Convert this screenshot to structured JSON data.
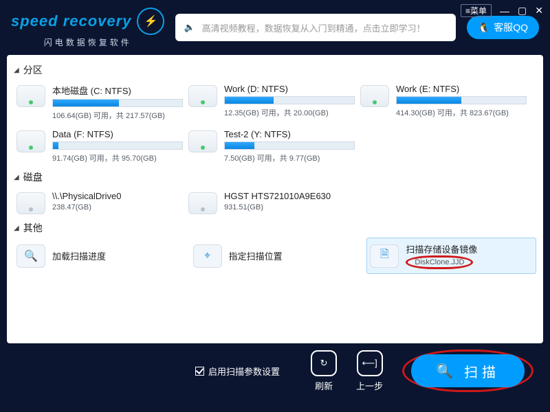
{
  "header": {
    "logo_text": "speed recovery",
    "logo_sub": "闪电数据恢复软件",
    "tutorial": "高清视频教程，数据恢复从入门到精通，点击立即学习！",
    "qq_label": "客服QQ",
    "menu_label": "菜单"
  },
  "sections": {
    "partition": "分区",
    "disk": "磁盘",
    "other": "其他"
  },
  "partitions": [
    {
      "title": "本地磁盘 (C: NTFS)",
      "meta": "106.64(GB) 可用，共 217.57(GB)",
      "fill": 51
    },
    {
      "title": "Work (D: NTFS)",
      "meta": "12.35(GB) 可用，共 20.00(GB)",
      "fill": 38
    },
    {
      "title": "Work (E: NTFS)",
      "meta": "414.30(GB) 可用，共 823.67(GB)",
      "fill": 50
    },
    {
      "title": "Data (F: NTFS)",
      "meta": "91.74(GB) 可用，共 95.70(GB)",
      "fill": 4
    },
    {
      "title": "Test-2 (Y: NTFS)",
      "meta": "7.50(GB) 可用，共 9.77(GB)",
      "fill": 23
    }
  ],
  "disks": [
    {
      "title": "\\\\.\\PhysicalDrive0",
      "meta": "238.47(GB)"
    },
    {
      "title": "HGST HTS721010A9E630",
      "meta": "931.51(GB)"
    }
  ],
  "other": {
    "load_progress": "加载扫描进度",
    "set_location": "指定扫描位置",
    "scan_image": "扫描存储设备镜像",
    "selected_file": "DiskClone.JJD"
  },
  "footer": {
    "enable_params": "启用扫描参数设置",
    "refresh": "刷新",
    "back": "上一步",
    "scan": "扫描"
  },
  "icons": {
    "lightning": "⚡",
    "speaker": "🔈",
    "qq": "🐧",
    "minimize": "—",
    "maximize": "▢",
    "close": "✕",
    "menu_arrow": "≡",
    "search": "🔍",
    "target": "⌖",
    "doc": "🗎",
    "refresh": "↻",
    "back": "⟵]"
  }
}
